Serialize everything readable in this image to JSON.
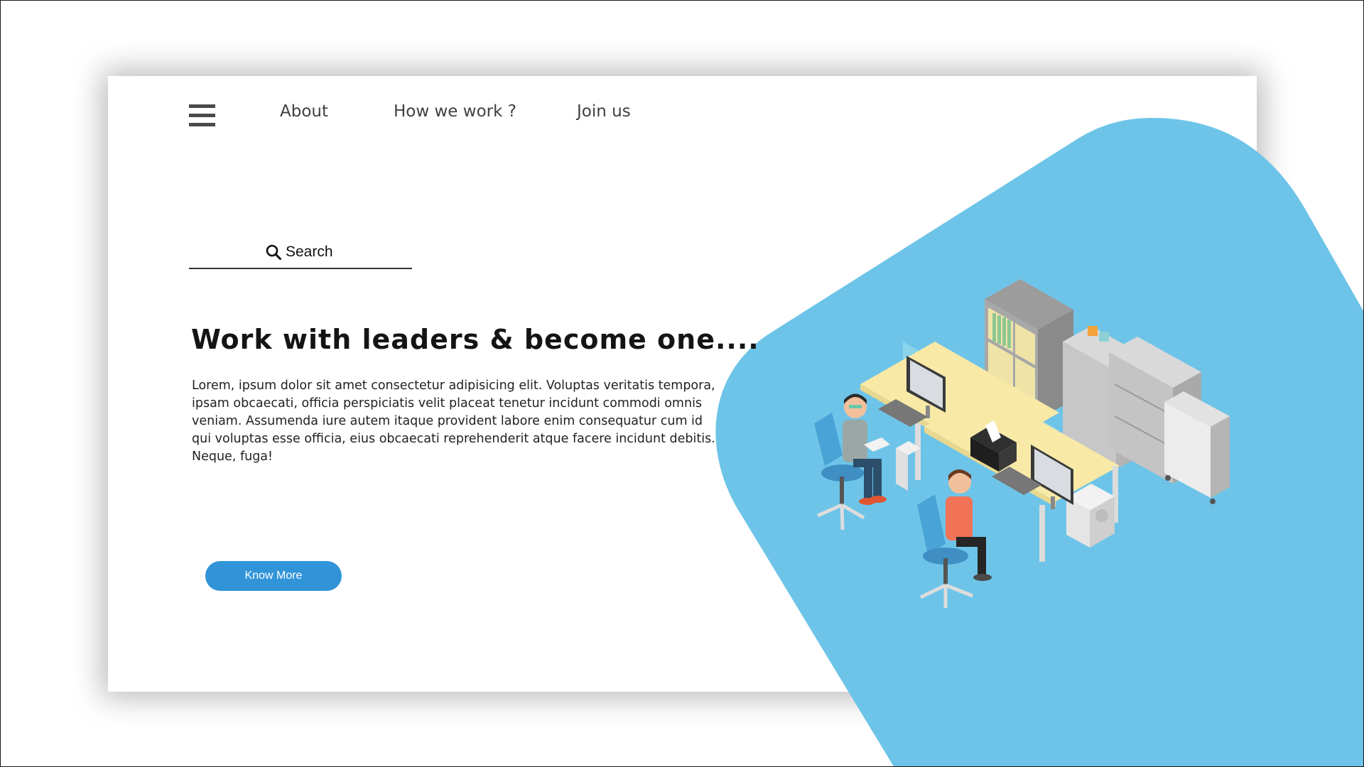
{
  "nav": {
    "menu_icon": "hamburger-menu-icon",
    "links": [
      "About",
      "How we work ?",
      "Join us"
    ]
  },
  "search": {
    "icon": "search-icon",
    "label": "Search"
  },
  "hero": {
    "headline": "Work with leaders & become one....",
    "body": "Lorem, ipsum dolor sit amet consectetur adipisicing elit. Voluptas veritatis tempora, ipsam obcaecati, officia perspiciatis velit placeat tenetur incidunt commodi omnis veniam. Assumenda iure autem itaque provident labore enim consequatur cum id qui voluptas esse officia, eius obcaecati reprehenderit atque facere incidunt debitis. Neque, fuga!",
    "button_label": "Know More"
  },
  "colors": {
    "accent_blob": "#6dc4e8",
    "button": "#3194d8",
    "text": "#222222"
  },
  "illustration": {
    "icon": "office-workspace-illustration"
  }
}
